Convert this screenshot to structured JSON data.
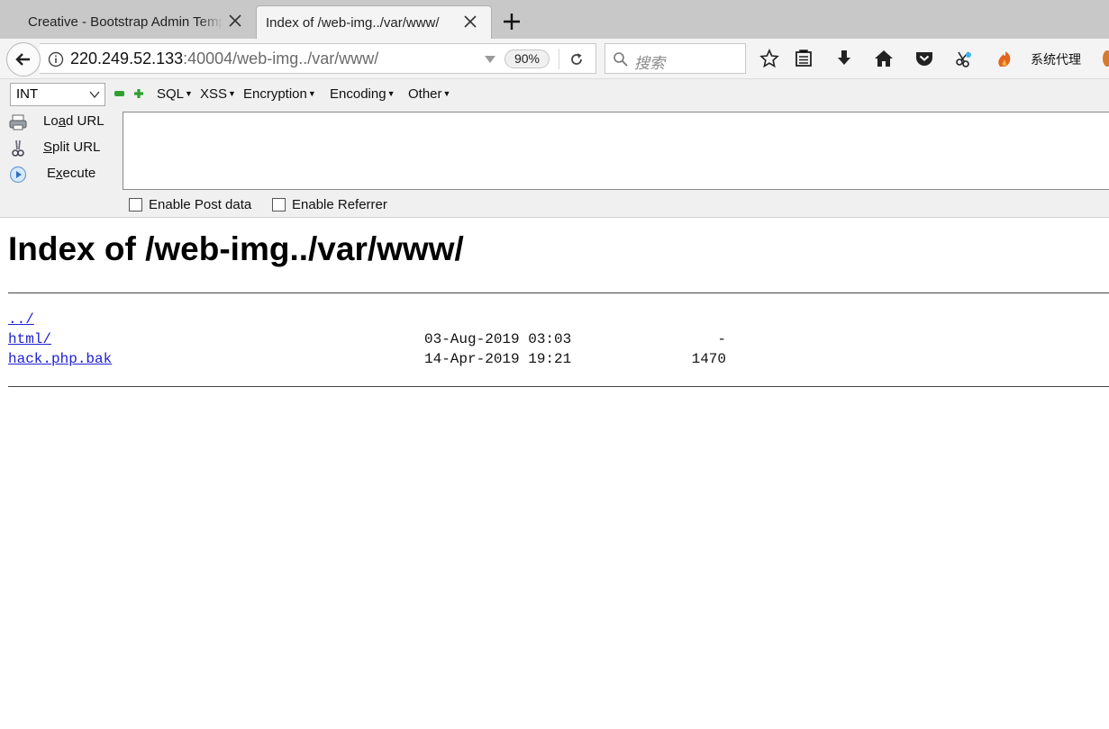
{
  "tabs": [
    {
      "title": "Creative - Bootstrap Admin Template",
      "active": false
    },
    {
      "title": "Index of /web-img../var/www/",
      "active": true
    }
  ],
  "navbar": {
    "url_host": "220.249.52.133",
    "url_rest": ":40004/web-img../var/www/",
    "zoom": "90%",
    "search_placeholder": "搜索",
    "proxy_label": "系统代理"
  },
  "hackbar": {
    "select_value": "INT",
    "menus": [
      "SQL",
      "XSS",
      "Encryption",
      "Encoding",
      "Other"
    ],
    "actions": [
      {
        "pre": "Lo",
        "key": "a",
        "post": "d URL"
      },
      {
        "pre": "",
        "key": "S",
        "post": "plit URL"
      },
      {
        "pre": "E",
        "key": "x",
        "post": "ecute"
      }
    ],
    "textarea_value": "",
    "checks": [
      "Enable Post data",
      "Enable Referrer"
    ]
  },
  "page": {
    "title": "Index of /web-img../var/www/",
    "entries": [
      {
        "name": "../",
        "date": "",
        "size": ""
      },
      {
        "name": "html/",
        "date": "03-Aug-2019 03:03",
        "size": "-"
      },
      {
        "name": "hack.php.bak",
        "date": "14-Apr-2019 19:21",
        "size": "1470"
      }
    ]
  },
  "colors": {
    "link": "#2020d0",
    "tabstrip": "#c8c8c8",
    "hackbar_green": "#2fa02f"
  }
}
